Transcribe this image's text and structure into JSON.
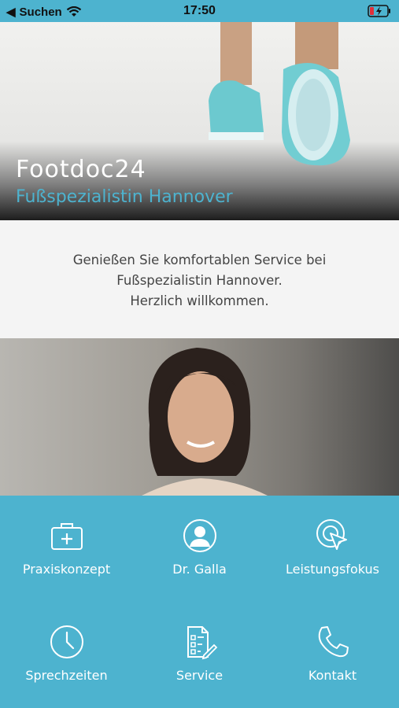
{
  "statusbar": {
    "back_label": "Suchen",
    "time": "17:50"
  },
  "hero": {
    "title": "Footdoc24",
    "subtitle": "Fußspezialistin Hannover"
  },
  "welcome": {
    "lines": [
      "Genießen Sie komfortablen Service bei",
      "Fußspezialistin Hannover.",
      "Herzlich willkommen."
    ]
  },
  "menu": {
    "items": [
      {
        "label": "Praxiskonzept",
        "icon": "first-aid-kit-icon"
      },
      {
        "label": "Dr. Galla",
        "icon": "user-circle-icon"
      },
      {
        "label": "Leistungsfokus",
        "icon": "cursor-target-icon"
      },
      {
        "label": "Sprechzeiten",
        "icon": "clock-icon"
      },
      {
        "label": "Service",
        "icon": "document-edit-icon"
      },
      {
        "label": "Kontakt",
        "icon": "phone-icon"
      }
    ]
  },
  "colors": {
    "accent": "#4db3cf",
    "panel": "#f4f4f4",
    "text": "#444444"
  }
}
